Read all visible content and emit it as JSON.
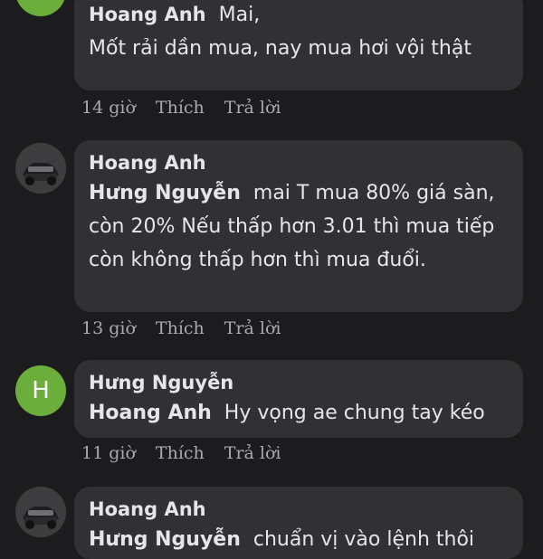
{
  "comments": [
    {
      "author": "Hoang Anh",
      "mention": "Mai,",
      "text": "Mốt rải dần mua, nay mua hơi vội thật",
      "time": "14 giờ",
      "like": "Thích",
      "reply": "Trả lời"
    },
    {
      "author": "Hoang Anh",
      "mention": "Hưng Nguyễn",
      "text": "mai T mua 80% giá sàn, còn 20% Nếu thấp hơn 3.01 thì mua tiếp còn không thấp hơn thì mua đuổi.",
      "time": "13 giờ",
      "like": "Thích",
      "reply": "Trả lời"
    },
    {
      "author": "Hưng Nguyễn",
      "avatar_letter": "H",
      "mention": "Hoang Anh",
      "text": "Hy vọng ae chung tay kéo",
      "time": "11 giờ",
      "like": "Thích",
      "reply": "Trả lời"
    },
    {
      "author": "Hoang Anh",
      "mention": "Hưng Nguyễn",
      "text": "chuẩn vị vào lệnh thôi"
    }
  ],
  "colors": {
    "background": "#1c1c1e",
    "bubble": "#313133",
    "avatar_green": "#6cae3c",
    "meta_text": "#a8aaad"
  }
}
